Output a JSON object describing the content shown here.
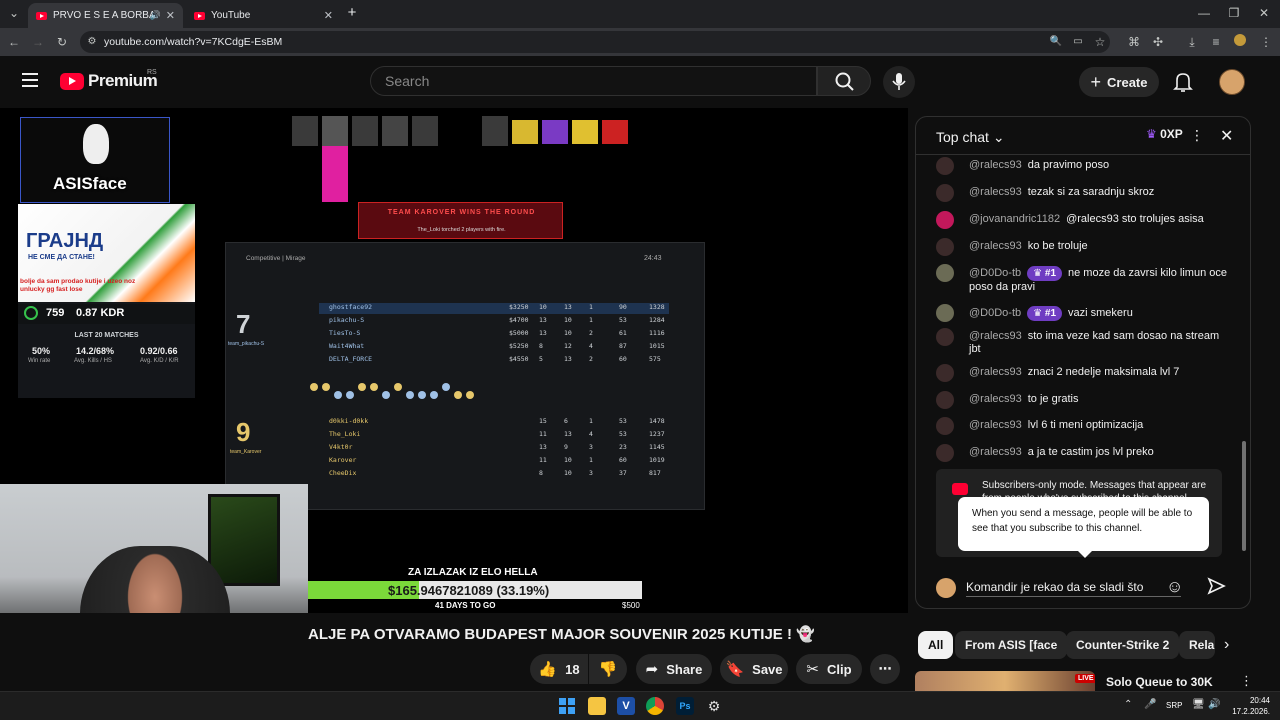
{
  "browser": {
    "tabs": [
      {
        "label": "PRVO E S E A BORBA ZA PR",
        "active": true
      },
      {
        "label": "YouTube",
        "active": false
      }
    ],
    "url": "youtube.com/watch?v=7KCdgE-EsBM",
    "new_tab_symbol": "+"
  },
  "header": {
    "logo_text": "Premium",
    "logo_country": "RS",
    "search_placeholder": "Search",
    "create_label": "Create"
  },
  "stream_overlay": {
    "channel_name": "ASISface",
    "ad_title": "ГРАЈНД",
    "ad_subtitle": "НЕ СМЕ ДА СТАНЕ!",
    "ad_text": "bolje da sam prodao kutije i uzeo noz unlucky gg fast lose",
    "elo_rank": "759",
    "elo_kd": "0.87 KDR",
    "last_matches_label": "LAST 20 MATCHES",
    "stats": [
      {
        "value": "50%",
        "label": "Win rate"
      },
      {
        "value": "14.2/68%",
        "label": "Avg. Kills / HS"
      },
      {
        "value": "0.92/0.66",
        "label": "Avg. K/D / K/R"
      }
    ],
    "kill_banner_title": "TEAM KAROVER WINS THE ROUND",
    "kill_banner_sub": "The_Loki torched 2 players with fire.",
    "scoreboard": {
      "title": "Competitive | Mirage",
      "timer": "24:43",
      "ct_score": "7",
      "ct_name": "team_pikachu-S",
      "t_score": "9",
      "t_name": "team_Karover",
      "ct_players": [
        {
          "name": "ghostface92",
          "money": "$3250",
          "k": "10",
          "d": "13",
          "a": "1",
          "hs": "90",
          "dmg": "1328"
        },
        {
          "name": "pikachu-S",
          "money": "$4700",
          "k": "13",
          "d": "10",
          "a": "1",
          "hs": "53",
          "dmg": "1284"
        },
        {
          "name": "TiesTo-S",
          "money": "$5000",
          "k": "13",
          "d": "10",
          "a": "2",
          "hs": "61",
          "dmg": "1116"
        },
        {
          "name": "Wait4What",
          "money": "$5250",
          "k": "8",
          "d": "12",
          "a": "4",
          "hs": "87",
          "dmg": "1015"
        },
        {
          "name": "DELTA_FORCE",
          "money": "$4550",
          "k": "5",
          "d": "13",
          "a": "2",
          "hs": "60",
          "dmg": "575"
        }
      ],
      "t_players": [
        {
          "name": "d0kki-d0kk",
          "k": "15",
          "d": "6",
          "a": "1",
          "hs": "53",
          "dmg": "1478"
        },
        {
          "name": "The_Loki",
          "k": "11",
          "d": "13",
          "a": "4",
          "hs": "53",
          "dmg": "1237"
        },
        {
          "name": "V4kt0r",
          "k": "13",
          "d": "9",
          "a": "3",
          "hs": "23",
          "dmg": "1145"
        },
        {
          "name": "Karover",
          "k": "11",
          "d": "10",
          "a": "1",
          "hs": "60",
          "dmg": "1019"
        },
        {
          "name": "CheeDix",
          "k": "8",
          "d": "10",
          "a": "3",
          "hs": "37",
          "dmg": "817"
        }
      ]
    },
    "goal_title": "ZA IZLAZAK IZ ELO HELLA",
    "goal_progress_text": "$165.9467821089 (33.19%)",
    "goal_progress": 0.3319,
    "goal_days": "41 DAYS TO GO",
    "goal_max": "$500"
  },
  "video": {
    "title": "ALJE PA OTVARAMO BUDAPEST MAJOR SOUVENIR 2025 KUTIJE ! 👻",
    "likes": "18",
    "share_label": "Share",
    "save_label": "Save",
    "clip_label": "Clip"
  },
  "chat": {
    "title": "Top chat",
    "xp": "0XP",
    "messages": [
      {
        "author": "@ralecs93",
        "text": "da pravimo poso",
        "rank": ""
      },
      {
        "author": "@ralecs93",
        "text": "tezak si za saradnju skroz",
        "rank": ""
      },
      {
        "author": "@jovanandric1182",
        "text": "@ralecs93 sto trolujes asisa",
        "rank": ""
      },
      {
        "author": "@ralecs93",
        "text": "ko be trolujе",
        "rank": ""
      },
      {
        "author": "@D0Do-tb",
        "text": "ne moze da zavrsi kilo limun oce poso da pravi",
        "rank": "#1"
      },
      {
        "author": "@D0Do-tb",
        "text": "vazi smekeru",
        "rank": "#1"
      },
      {
        "author": "@ralecs93",
        "text": "sto ima veze kad sam dosao na stream jbt",
        "rank": ""
      },
      {
        "author": "@ralecs93",
        "text": "znaci 2 nedelje maksimala lvl 7",
        "rank": ""
      },
      {
        "author": "@ralecs93",
        "text": "to je gratis",
        "rank": ""
      },
      {
        "author": "@ralecs93",
        "text": "lvl 6 ti meni optimizacija",
        "rank": ""
      },
      {
        "author": "@ralecs93",
        "text": "a ja te castim jos lvl preko",
        "rank": ""
      }
    ],
    "sub_notice": "Subscribers-only mode. Messages that appear are from people who've subscribed to this channel",
    "tooltip": "When you send a message, people will be able to see that you subscribe to this channel.",
    "input_value": "Komandir je rekao da se sladi što"
  },
  "chips": [
    "All",
    "From ASIS [face",
    "Counter-Strike 2",
    "Rela"
  ],
  "recommendation": {
    "title": "Solo Queue to 30K",
    "badge": "LIVE"
  },
  "taskbar": {
    "language": "SRP",
    "time": "20:44",
    "date": "17.2.2026."
  },
  "colors": {
    "brand": "#ff0033",
    "rank_badge": "#6f3dc2",
    "goal_fill": "#7bd93a"
  }
}
